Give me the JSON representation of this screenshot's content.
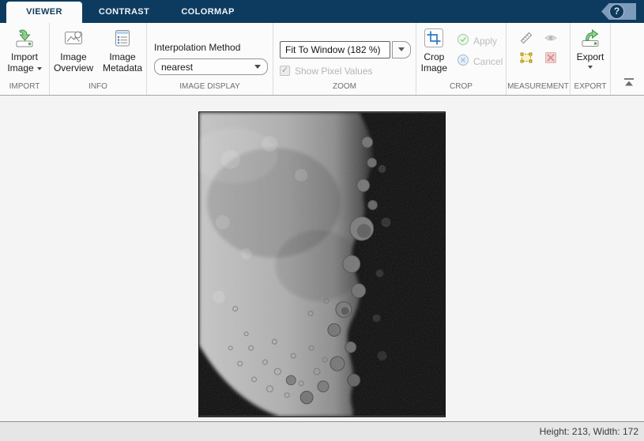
{
  "tab_bar": {
    "tabs": [
      {
        "label": "VIEWER",
        "active": true
      },
      {
        "label": "CONTRAST",
        "active": false
      },
      {
        "label": "COLORMAP",
        "active": false
      }
    ],
    "help": {
      "glyph": "?"
    }
  },
  "ribbon": {
    "import": {
      "label": "IMPORT",
      "import_image": {
        "line1": "Import",
        "line2": "Image"
      }
    },
    "info": {
      "label": "INFO",
      "image_overview": {
        "line1": "Image",
        "line2": "Overview"
      },
      "image_metadata": {
        "line1": "Image",
        "line2": "Metadata"
      }
    },
    "image_display": {
      "label": "IMAGE DISPLAY",
      "interpolation_method_label": "Interpolation Method",
      "interpolation_method_value": "nearest"
    },
    "zoom": {
      "label": "ZOOM",
      "zoom_level_value": "Fit To Window (182 %)",
      "show_pixel_values": {
        "label": "Show Pixel Values",
        "checked": true,
        "check_glyph": "✓"
      }
    },
    "crop": {
      "label": "CROP",
      "crop_image": {
        "line1": "Crop",
        "line2": "Image"
      },
      "apply_label": "Apply",
      "cancel_label": "Cancel"
    },
    "measurement": {
      "label": "MEASUREMENT"
    },
    "export": {
      "label": "EXPORT",
      "export_label": "Export"
    }
  },
  "status_bar": {
    "image_size": "Height: 213, Width: 172"
  },
  "colors": {
    "tab_bar_background": "#0d3b60",
    "ribbon_background": "#fbfbfb",
    "accent_green": "#3f9142",
    "accent_blue": "#2e7bc4",
    "disabled_text": "#b5b5b5",
    "roi_yellow": "#e8c84a",
    "delete_red": "#cc8f8f"
  }
}
